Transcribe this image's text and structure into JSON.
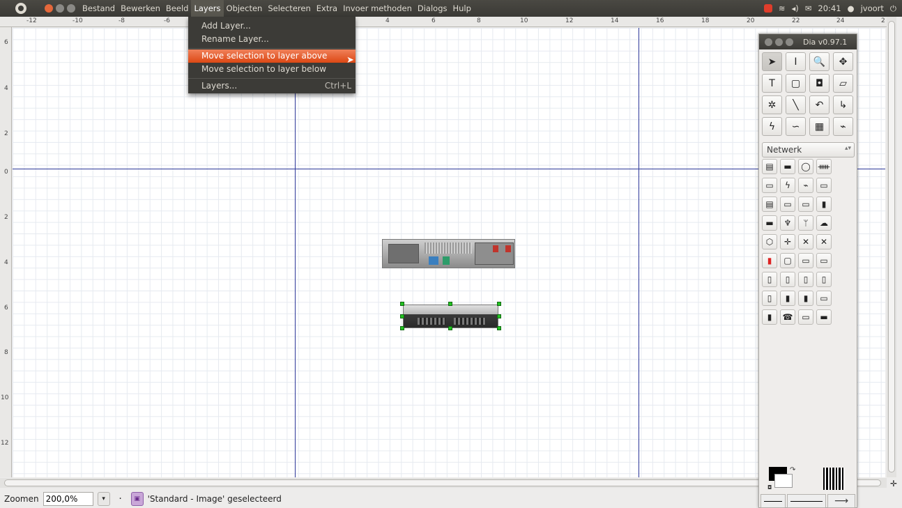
{
  "topbar": {
    "menu": [
      "Bestand",
      "Bewerken",
      "Beeld",
      "Layers",
      "Objecten",
      "Selecteren",
      "Extra",
      "Invoer methoden",
      "Dialogs",
      "Hulp"
    ],
    "active_menu": "Layers",
    "tray": {
      "time": "20:41",
      "user": "jvoort",
      "wifi_icon": "wifi-icon",
      "volume_icon": "volume-icon",
      "mail_icon": "mail-icon",
      "power_icon": "power-icon"
    }
  },
  "ruler": {
    "h_labels": [
      "-12",
      "-10",
      "-8",
      "-6",
      "4",
      "6",
      "8",
      "10",
      "12",
      "14",
      "16",
      "18",
      "20",
      "22",
      "24",
      "2"
    ],
    "v_labels": [
      "6",
      "4",
      "2",
      "0",
      "2",
      "4",
      "6",
      "8",
      "10",
      "12"
    ]
  },
  "dropdown": {
    "items": [
      {
        "label": "Add Layer...",
        "accel": ""
      },
      {
        "label": "Rename Layer...",
        "accel": ""
      },
      {
        "label": "Move selection to layer above",
        "accel": ""
      },
      {
        "label": "Move selection to layer below",
        "accel": ""
      },
      {
        "label": "Layers...",
        "accel": "Ctrl+L"
      }
    ],
    "highlighted": "Move selection to layer above"
  },
  "toolbox": {
    "title": "Dia v0.97.1",
    "tools": [
      {
        "icon": "pointer-icon",
        "glyph": "➤"
      },
      {
        "icon": "text-cursor-icon",
        "glyph": "I"
      },
      {
        "icon": "magnify-icon",
        "glyph": "🔍"
      },
      {
        "icon": "move-icon",
        "glyph": "✥"
      },
      {
        "icon": "text-tool-icon",
        "glyph": "T"
      },
      {
        "icon": "box-icon",
        "glyph": "▢"
      },
      {
        "icon": "ellipse-icon",
        "glyph": "◘"
      },
      {
        "icon": "polygon-icon",
        "glyph": "▱"
      },
      {
        "icon": "beziergon-icon",
        "glyph": "✲"
      },
      {
        "icon": "line-icon",
        "glyph": "╲"
      },
      {
        "icon": "arc-icon",
        "glyph": "↶"
      },
      {
        "icon": "zigzag-icon",
        "glyph": "↳"
      },
      {
        "icon": "polyline-icon",
        "glyph": "ϟ"
      },
      {
        "icon": "bezier-icon",
        "glyph": "∽"
      },
      {
        "icon": "image-icon",
        "glyph": "▦"
      },
      {
        "icon": "outline-icon",
        "glyph": "⌁"
      }
    ],
    "sheet": "Netwerk",
    "shapes": [
      "computer-icon",
      "monitor-icon",
      "storage-icon",
      "hub-icon",
      "printer-icon",
      "lightning-icon",
      "bolt-icon",
      "modem-icon",
      "rack-icon",
      "switch-icon",
      "scanner-icon",
      "phone-tower-icon",
      "flat-device-icon",
      "antenna-icon",
      "fork-icon",
      "cloud-icon",
      "hexagon-icon",
      "router-icon",
      "crossover-icon",
      "cross-icon",
      "firewall-icon",
      "display-icon",
      "bridge-icon",
      "nas-icon",
      "tower-icon",
      "tower2-icon",
      "tower3-icon",
      "tower4-icon",
      "tower5-icon",
      "tower6-icon",
      "tower7-icon",
      "tower8-icon",
      "mobile-icon",
      "telephone-icon",
      "desk-icon",
      "chair-icon"
    ]
  },
  "status": {
    "zoom_label": "Zoomen",
    "zoom_value": "200,0%",
    "message": "'Standard - Image' geselecteerd"
  }
}
